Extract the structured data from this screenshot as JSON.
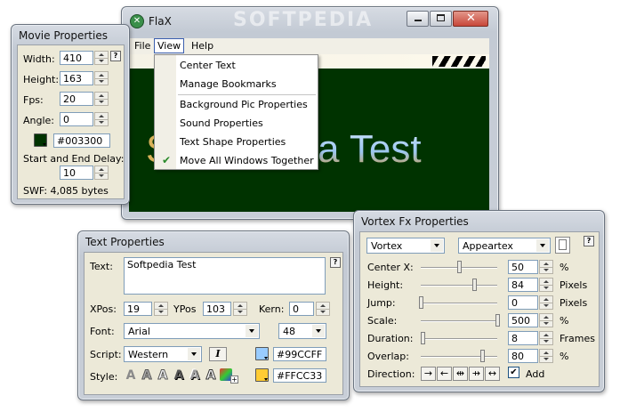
{
  "watermark": "SOFTPEDIA",
  "main": {
    "title": "FlaX",
    "menus": [
      "File",
      "View",
      "Help"
    ],
    "stage_text": "Softpedia Test",
    "stage_text_hidden_part": "So",
    "stage_text_visible_part": "a Test",
    "view_menu": {
      "items": [
        "Center Text",
        "Manage Bookmarks",
        "Background Pic Properties",
        "Sound Properties",
        "Text Shape Properties",
        "Move All Windows Together"
      ],
      "checked_item": "Move All Windows Together"
    }
  },
  "movie": {
    "title": "Movie Properties",
    "width_label": "Width:",
    "width": "410",
    "height_label": "Height:",
    "height": "163",
    "fps_label": "Fps:",
    "fps": "20",
    "angle_label": "Angle:",
    "angle": "0",
    "color": "#003300",
    "delay_label": "Start and End Delay:",
    "delay": "10",
    "swf_size": "SWF: 4,085 bytes",
    "help": "?"
  },
  "text": {
    "title": "Text Properties",
    "text_label": "Text:",
    "text_value": "Softpedia Test",
    "xpos_label": "XPos:",
    "xpos": "19",
    "ypos_label": "YPos",
    "ypos": "103",
    "kern_label": "Kern:",
    "kern": "0",
    "font_label": "Font:",
    "font": "Arial",
    "size": "48",
    "script_label": "Script:",
    "script": "Western",
    "italic": "I",
    "color1": "#99CCFF",
    "color2": "#FFCC33",
    "style_label": "Style:",
    "style_glyphs": [
      "A",
      "A",
      "A",
      "A",
      "A",
      "A"
    ],
    "help": "?"
  },
  "vortex": {
    "title": "Vortex Fx Properties",
    "effect": "Vortex",
    "mode": "Appeartex",
    "help": "?",
    "params": [
      {
        "label": "Center X:",
        "value": "50",
        "unit": "%",
        "level": 0.5
      },
      {
        "label": "Height:",
        "value": "84",
        "unit": "Pixels",
        "level": 0.7
      },
      {
        "label": "Jump:",
        "value": "0",
        "unit": "Pixels",
        "level": 0.0
      },
      {
        "label": "Scale:",
        "value": "500",
        "unit": "%",
        "level": 1.0
      },
      {
        "label": "Duration:",
        "value": "8",
        "unit": "Frames",
        "level": 0.02
      },
      {
        "label": "Overlap:",
        "value": "80",
        "unit": "%",
        "level": 0.8
      }
    ],
    "direction_label": "Direction:",
    "directions": [
      "→",
      "←",
      "⇹",
      "⇸",
      "↔"
    ],
    "add_label": "Add",
    "add_checked": true
  },
  "colors": {
    "stage_bg": "#003300",
    "panel_bg": "#ece9d8",
    "titlebar": "#c9cfd8",
    "close": "#c8483a"
  }
}
